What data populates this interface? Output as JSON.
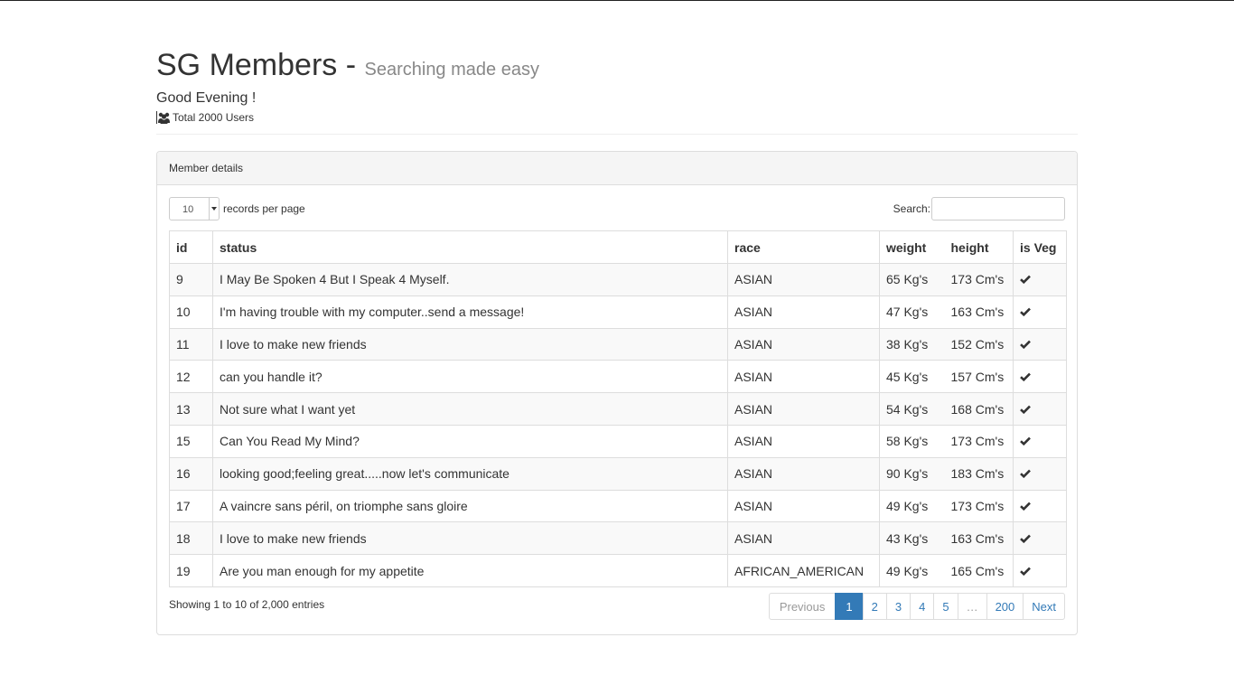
{
  "header": {
    "title": "SG Members",
    "separator": "-",
    "subtitle": "Searching made easy",
    "greeting": "Good Evening !",
    "total_users_text": "Total 2000 Users",
    "users_icon": "users-icon"
  },
  "panel": {
    "heading": "Member details",
    "length_select_value": "10",
    "length_label": "records per page",
    "search_label": "Search:",
    "search_value": ""
  },
  "table": {
    "columns": [
      "id",
      "status",
      "race",
      "weight",
      "height",
      "is Veg"
    ],
    "rows": [
      {
        "id": "9",
        "status": "I May Be Spoken 4 But I Speak 4 Myself.",
        "race": "ASIAN",
        "weight": "65 Kg's",
        "height": "173 Cm's",
        "is_veg": true
      },
      {
        "id": "10",
        "status": "I'm having trouble with my computer..send a message!",
        "race": "ASIAN",
        "weight": "47 Kg's",
        "height": "163 Cm's",
        "is_veg": true
      },
      {
        "id": "11",
        "status": "I love to make new friends",
        "race": "ASIAN",
        "weight": "38 Kg's",
        "height": "152 Cm's",
        "is_veg": true
      },
      {
        "id": "12",
        "status": "can you handle it?",
        "race": "ASIAN",
        "weight": "45 Kg's",
        "height": "157 Cm's",
        "is_veg": true
      },
      {
        "id": "13",
        "status": "Not sure what I want yet",
        "race": "ASIAN",
        "weight": "54 Kg's",
        "height": "168 Cm's",
        "is_veg": true
      },
      {
        "id": "15",
        "status": "Can You Read My Mind?",
        "race": "ASIAN",
        "weight": "58 Kg's",
        "height": "173 Cm's",
        "is_veg": true
      },
      {
        "id": "16",
        "status": "looking good;feeling great.....now let's communicate",
        "race": "ASIAN",
        "weight": "90 Kg's",
        "height": "183 Cm's",
        "is_veg": true
      },
      {
        "id": "17",
        "status": "A vaincre sans péril, on triomphe sans gloire",
        "race": "ASIAN",
        "weight": "49 Kg's",
        "height": "173 Cm's",
        "is_veg": true
      },
      {
        "id": "18",
        "status": "I love to make new friends",
        "race": "ASIAN",
        "weight": "43 Kg's",
        "height": "163 Cm's",
        "is_veg": true
      },
      {
        "id": "19",
        "status": "Are you man enough for my appetite",
        "race": "AFRICAN_AMERICAN",
        "weight": "49 Kg's",
        "height": "165 Cm's",
        "is_veg": true
      }
    ],
    "check_icon": "check-icon"
  },
  "footer": {
    "info": "Showing 1 to 10 of 2,000 entries",
    "pagination": {
      "previous": "Previous",
      "pages": [
        "1",
        "2",
        "3",
        "4",
        "5"
      ],
      "ellipsis": "…",
      "last": "200",
      "next": "Next",
      "active": "1"
    }
  },
  "colors": {
    "accent": "#337ab7",
    "panel_heading_bg": "#f5f5f5",
    "border": "#dddddd"
  }
}
